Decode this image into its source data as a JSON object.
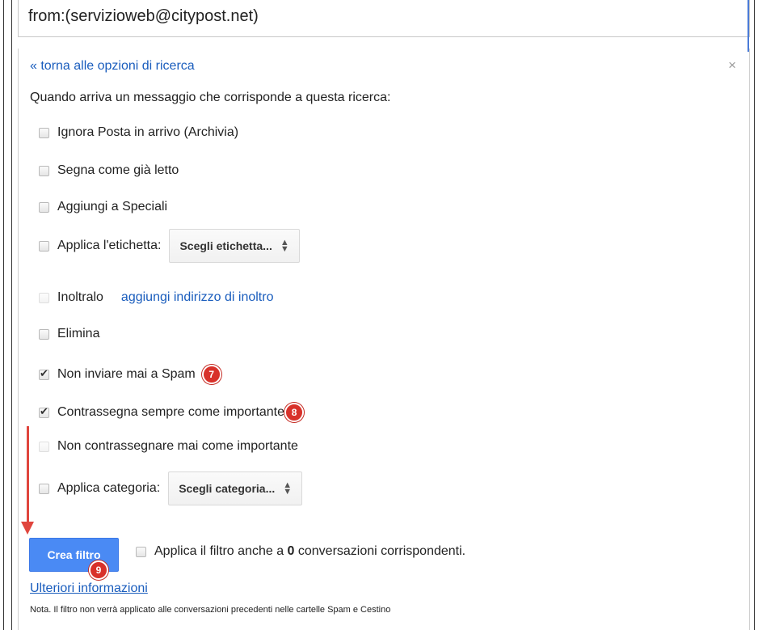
{
  "search": {
    "query": "from:(servizioweb@citypost.net)"
  },
  "panel": {
    "back_link": "« torna alle opzioni di ricerca",
    "close_icon": "×",
    "intro": "Quando arriva un messaggio che corrisponde a questa ricerca:"
  },
  "options": {
    "skip_inbox": {
      "label": "Ignora Posta in arrivo (Archivia)",
      "checked": false
    },
    "mark_read": {
      "label": "Segna come già letto",
      "checked": false
    },
    "star": {
      "label": "Aggiungi a Speciali",
      "checked": false
    },
    "apply_label": {
      "label": "Applica l'etichetta:",
      "select": "Scegli etichetta...",
      "checked": false
    },
    "forward": {
      "label": "Inoltralo",
      "link": "aggiungi indirizzo di inoltro",
      "checked": false,
      "disabled": true
    },
    "delete": {
      "label": "Elimina",
      "checked": false
    },
    "never_spam": {
      "label": "Non inviare mai a Spam",
      "checked": true,
      "badge": "7"
    },
    "always_important": {
      "label": "Contrassegna sempre come importante",
      "checked": true,
      "badge": "8"
    },
    "never_important": {
      "label": "Non contrassegnare mai come importante",
      "checked": false,
      "disabled": true
    },
    "apply_category": {
      "label": "Applica categoria:",
      "select": "Scegli categoria...",
      "checked": false
    }
  },
  "footer": {
    "create_button": "Crea filtro",
    "create_badge": "9",
    "apply_text_prefix": "Applica il filtro anche a ",
    "apply_count": "0",
    "apply_text_suffix": " conversazioni corrispondenti.",
    "more_info": "Ulteriori informazioni",
    "note": "Nota. Il filtro non verrà applicato alle conversazioni precedenti nelle cartelle Spam e Cestino"
  },
  "colors": {
    "link": "#1a5dbd",
    "button": "#4a8af4",
    "badge": "#d8312a",
    "arrow": "#e0453d"
  }
}
